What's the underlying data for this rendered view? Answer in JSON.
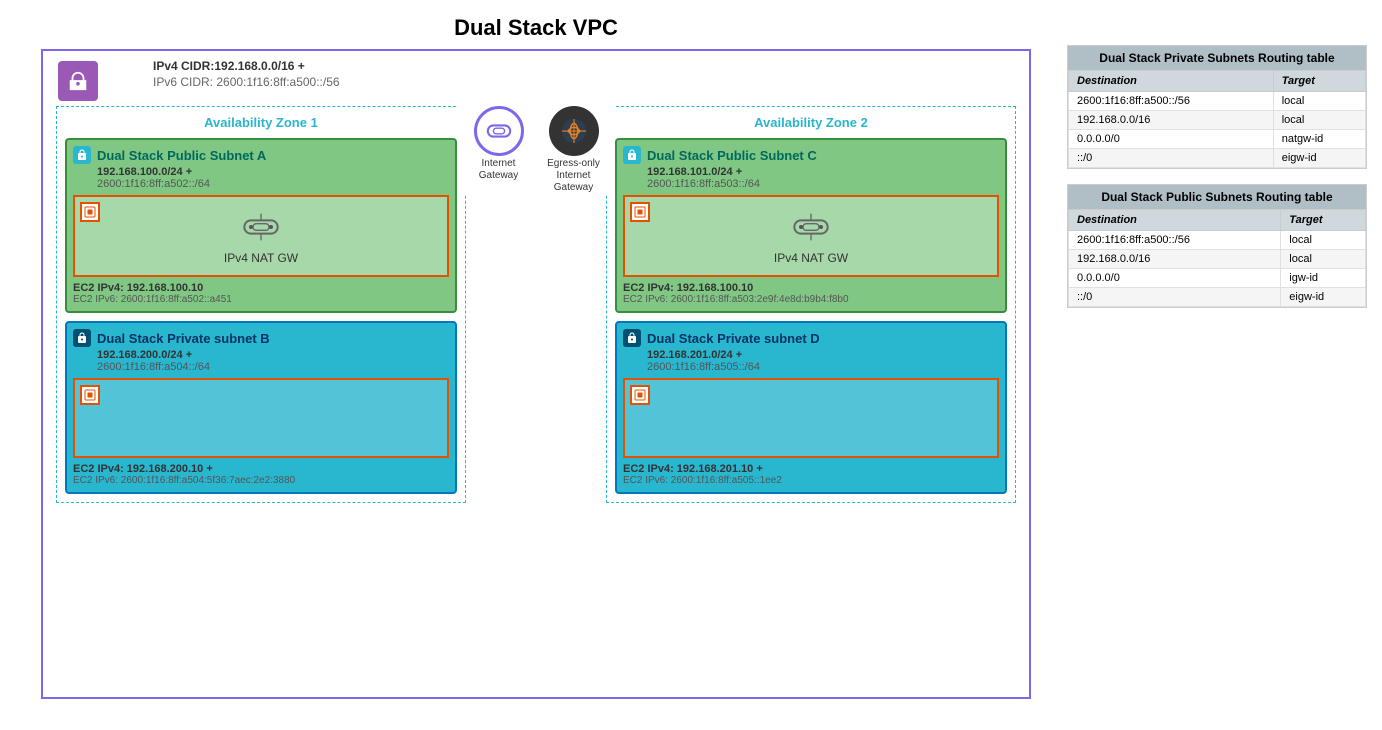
{
  "title": "Dual Stack VPC",
  "vpc": {
    "ipv4_cidr": "IPv4 CIDR:192.168.0.0/16 +",
    "ipv6_cidr": "IPv6 CIDR: 2600:1f16:8ff:a500::/56"
  },
  "az1": {
    "title": "Availability Zone 1",
    "public_subnet": {
      "title": "Dual Stack Public Subnet A",
      "ipv4": "192.168.100.0/24 +",
      "ipv6": "2600:1f16:8ff:a502::/64",
      "nat_gw_label": "IPv4 NAT GW",
      "ec2_ipv4": "EC2 IPv4: 192.168.100.10",
      "ec2_ipv6": "EC2 IPv6: 2600:1f16:8ff:a502::a451"
    },
    "private_subnet": {
      "title": "Dual Stack Private subnet B",
      "ipv4": "192.168.200.0/24 +",
      "ipv6": "2600:1f16:8ff:a504::/64",
      "ec2_ipv4": "EC2 IPv4: 192.168.200.10 +",
      "ec2_ipv6": "EC2 IPv6: 2600:1f16:8ff:a504:5f36:7aec:2e2:3880"
    }
  },
  "az2": {
    "title": "Availability Zone 2",
    "public_subnet": {
      "title": "Dual Stack Public Subnet C",
      "ipv4": "192.168.101.0/24 +",
      "ipv6": "2600:1f16:8ff:a503::/64",
      "nat_gw_label": "IPv4 NAT GW",
      "ec2_ipv4": "EC2 IPv4: 192.168.100.10",
      "ec2_ipv6": "EC2 IPv6: 2600:1f16:8ff:a503:2e9f:4e8d:b9b4:f8b0"
    },
    "private_subnet": {
      "title": "Dual Stack Private subnet D",
      "ipv4": "192.168.201.0/24 +",
      "ipv6": "2600:1f16:8ff:a505::/64",
      "ec2_ipv4": "EC2 IPv4: 192.168.201.10 +",
      "ec2_ipv6": "EC2 IPv6: 2600:1f16:8ff:a505::1ee2"
    }
  },
  "gateways": {
    "igw_label": "Internet Gateway",
    "eigw_label": "Egress-only Internet Gateway"
  },
  "routing_tables": {
    "private": {
      "title": "Dual Stack Private Subnets Routing table",
      "col1": "Destination",
      "col2": "Target",
      "rows": [
        {
          "dest": "2600:1f16:8ff:a500::/56",
          "target": "local"
        },
        {
          "dest": "192.168.0.0/16",
          "target": "local"
        },
        {
          "dest": "0.0.0.0/0",
          "target": "natgw-id"
        },
        {
          "dest": "::/0",
          "target": "eigw-id"
        }
      ]
    },
    "public": {
      "title": "Dual Stack Public Subnets Routing table",
      "col1": "Destination",
      "col2": "Target",
      "rows": [
        {
          "dest": "2600:1f16:8ff:a500::/56",
          "target": "local"
        },
        {
          "dest": "192.168.0.0/16",
          "target": "local"
        },
        {
          "dest": "0.0.0.0/0",
          "target": "igw-id"
        },
        {
          "dest": "::/0",
          "target": "eigw-id"
        }
      ]
    }
  }
}
